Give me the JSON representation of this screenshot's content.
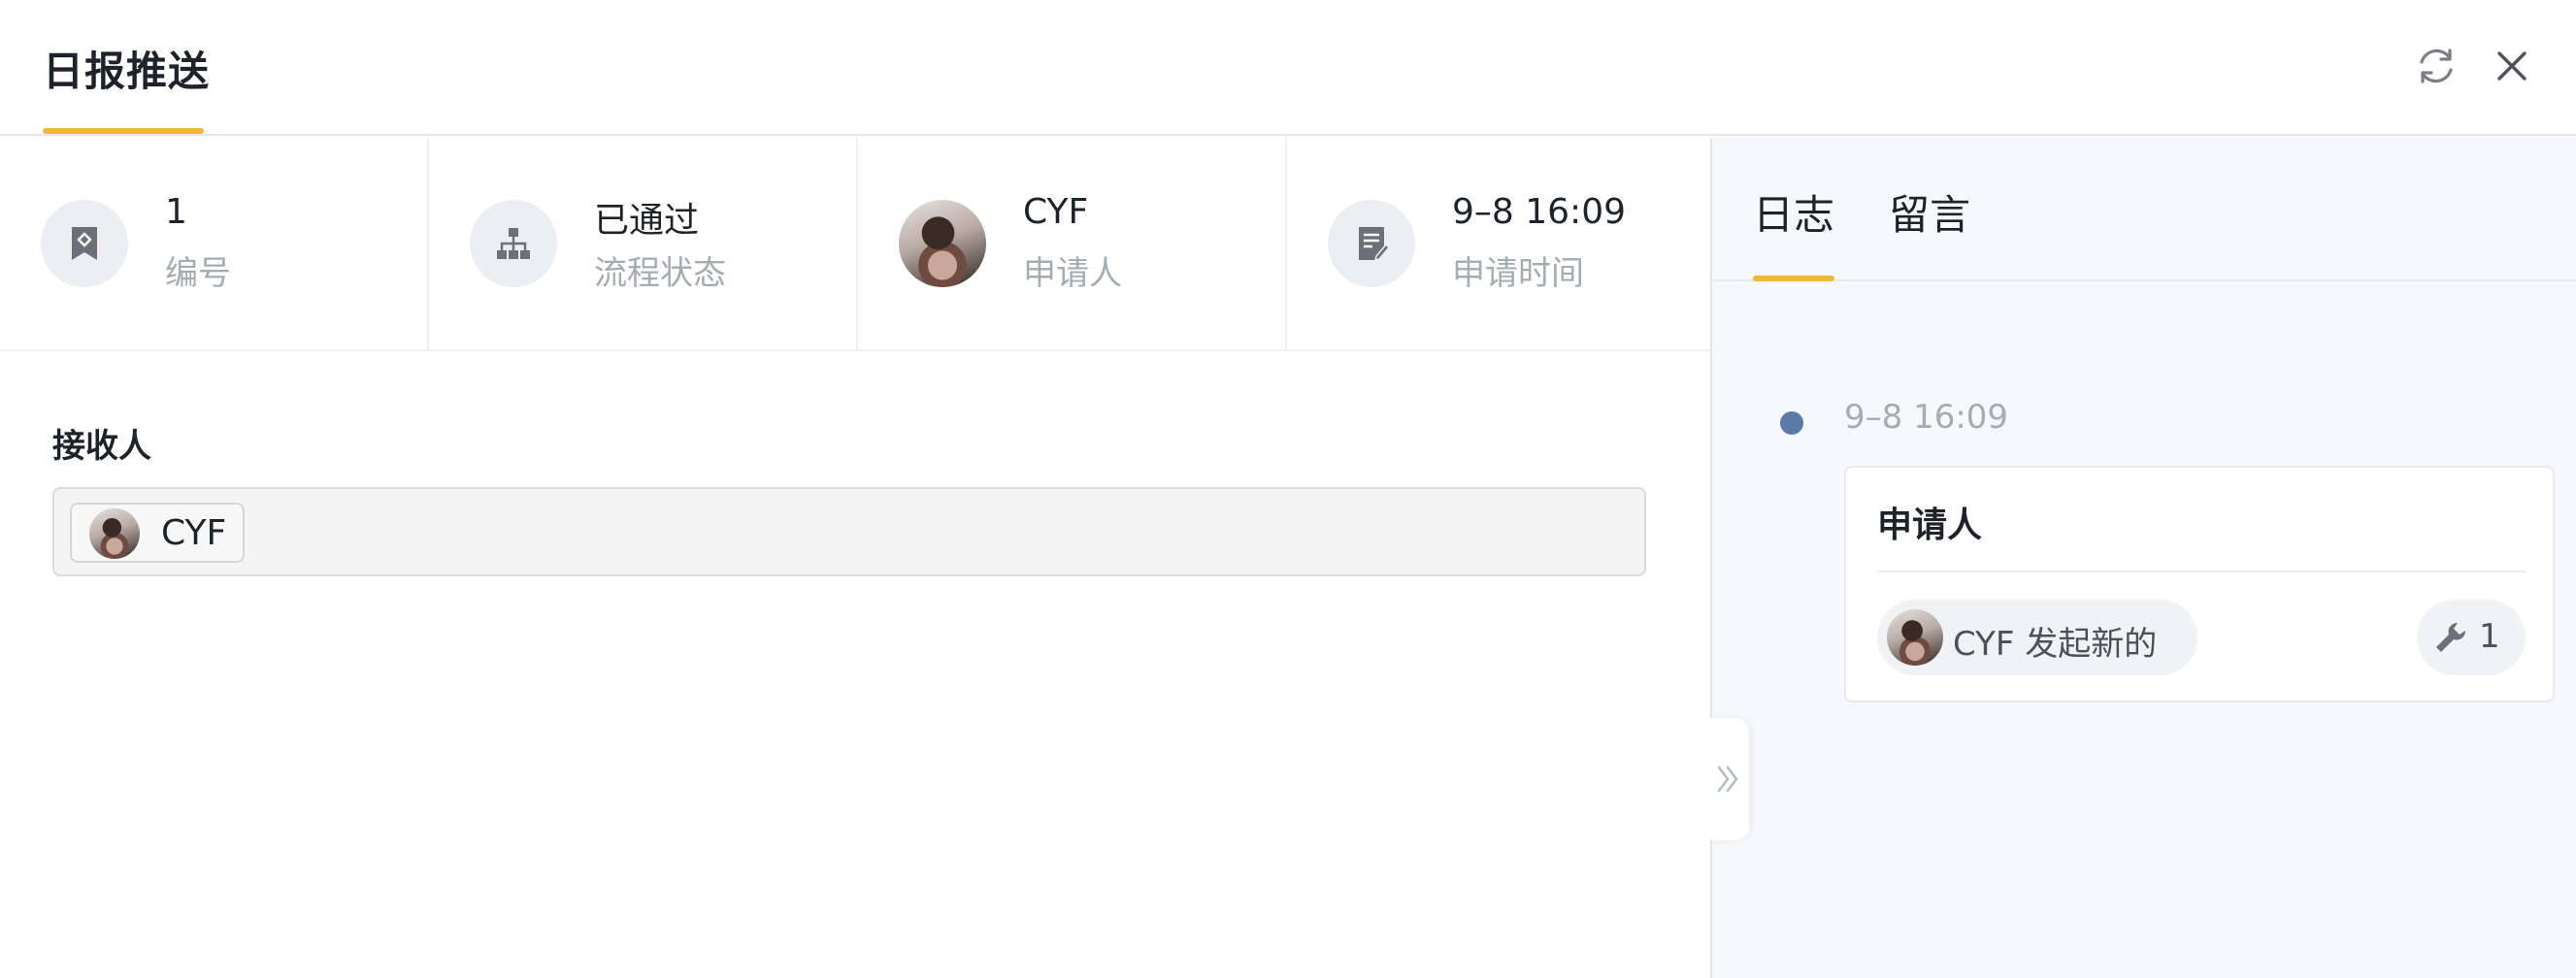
{
  "header": {
    "title": "日报推送",
    "refresh_icon": "refresh-icon",
    "close_icon": "close-icon",
    "accent_color": "#f0b73c"
  },
  "info": [
    {
      "icon": "bookmark-icon",
      "value": "1",
      "label": "编号"
    },
    {
      "icon": "org-chart-icon",
      "value": "已通过",
      "label": "流程状态"
    },
    {
      "icon": "avatar",
      "value": "CYF",
      "label": "申请人"
    },
    {
      "icon": "edit-document-icon",
      "value": "9–8 16:09",
      "label": "申请时间"
    }
  ],
  "receiver": {
    "label": "接收人",
    "tags": [
      {
        "name": "CYF"
      }
    ]
  },
  "panel": {
    "tabs": [
      {
        "label": "日志",
        "active": true
      },
      {
        "label": "留言",
        "active": false
      }
    ],
    "timeline": [
      {
        "time": "9–8 16:09",
        "title": "申请人",
        "action": "CYF 发起新的",
        "count": "1",
        "count_icon": "wrench-icon",
        "dot_color": "#5b7aa8"
      }
    ]
  },
  "collapse_icon": "double-chevron-right-icon"
}
